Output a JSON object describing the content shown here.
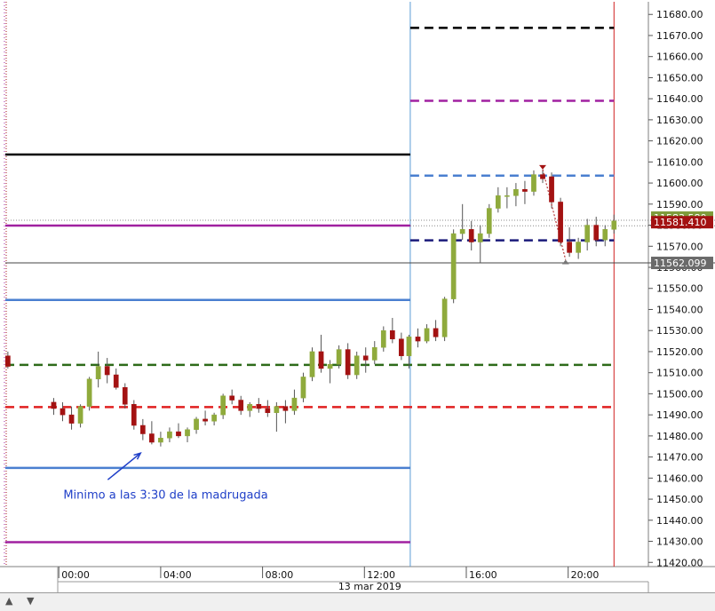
{
  "chart_data": {
    "type": "candlestick",
    "y_ticks": [
      "11420.00",
      "11430.00",
      "11440.00",
      "11450.00",
      "11460.00",
      "11470.00",
      "11480.00",
      "11490.00",
      "11500.00",
      "11510.00",
      "11520.00",
      "11530.00",
      "11540.00",
      "11550.00",
      "11560.00",
      "11570.00",
      "11580.00",
      "11590.00",
      "11600.00",
      "11610.00",
      "11620.00",
      "11630.00",
      "11640.00",
      "11650.00",
      "11660.00",
      "11670.00",
      "11680.00"
    ],
    "ylim": [
      11418,
      11686
    ],
    "x_ticks": [
      "00:00",
      "04:00",
      "08:00",
      "12:00",
      "16:00",
      "20:00"
    ],
    "x_tick_hours": [
      0,
      4,
      8,
      12,
      16,
      20
    ],
    "xlim_hours": [
      -2.1,
      23.15
    ],
    "date_label": "13 mar 2019",
    "date_label_hour": 10.1,
    "last_price_label": "11581.410",
    "crosshair_label": "11562.099",
    "partial_label": "11583.580",
    "crosshair_value": 11562.099,
    "last_price_value": 11581.41,
    "partial_value": 11583.58,
    "annotation": {
      "text": "Minimo a las 3:30 de la madrugada",
      "x_hour": -0.1,
      "y": 11452,
      "arrow_from": [
        -0.1,
        11455
      ],
      "arrow_to": [
        3.0,
        11471
      ]
    },
    "session_line_hour": 13.8,
    "end_line_hour": 21.8,
    "colors": {
      "up": "#8faa3c",
      "down": "#a31212",
      "session": "#5b9bd5",
      "end": "#d02020",
      "annotation": "#1f3fc8",
      "black": "#000000",
      "magenta": "#a020a0",
      "blue": "#4a7fd0",
      "green": "#2e6b1a",
      "red": "#e02020",
      "navy": "#1a1a7a"
    },
    "levels": [
      {
        "y": 11613.5,
        "x0": -2.1,
        "x1": 13.8,
        "color": "#000000",
        "dash": false,
        "w": 2.5
      },
      {
        "y": 11579.8,
        "x0": -2.1,
        "x1": 13.8,
        "color": "#a020a0",
        "dash": false,
        "w": 2.5
      },
      {
        "y": 11544.5,
        "x0": -2.1,
        "x1": 13.8,
        "color": "#4a7fd0",
        "dash": false,
        "w": 2.5
      },
      {
        "y": 11513.7,
        "x0": -2.1,
        "x1": 21.8,
        "color": "#2e6b1a",
        "dash": true,
        "w": 2.5
      },
      {
        "y": 11493.7,
        "x0": -2.1,
        "x1": 21.8,
        "color": "#e02020",
        "dash": true,
        "w": 2.5
      },
      {
        "y": 11464.8,
        "x0": -2.1,
        "x1": 13.8,
        "color": "#4a7fd0",
        "dash": false,
        "w": 2.5
      },
      {
        "y": 11429.6,
        "x0": -2.1,
        "x1": 13.8,
        "color": "#a020a0",
        "dash": false,
        "w": 2.5
      },
      {
        "y": 11673.6,
        "x0": 13.8,
        "x1": 21.8,
        "color": "#000000",
        "dash": true,
        "w": 2.5
      },
      {
        "y": 11639.0,
        "x0": 13.8,
        "x1": 21.8,
        "color": "#a020a0",
        "dash": true,
        "w": 2.5
      },
      {
        "y": 11603.5,
        "x0": 13.8,
        "x1": 21.8,
        "color": "#4a7fd0",
        "dash": true,
        "w": 2.5
      },
      {
        "y": 11572.8,
        "x0": 13.8,
        "x1": 21.8,
        "color": "#1a1a7a",
        "dash": true,
        "w": 2.5
      }
    ],
    "candles": [
      [
        -2.0,
        11518,
        11520,
        11512,
        11513
      ],
      [
        -0.2,
        11496,
        11498,
        11490,
        11493
      ],
      [
        0.15,
        11493,
        11496,
        11487,
        11490
      ],
      [
        0.5,
        11490,
        11494,
        11483,
        11486
      ],
      [
        0.85,
        11486,
        11495,
        11484,
        11494
      ],
      [
        1.2,
        11494,
        11508,
        11492,
        11507
      ],
      [
        1.55,
        11507,
        11520,
        11503,
        11513
      ],
      [
        1.9,
        11513,
        11517,
        11505,
        11509
      ],
      [
        2.25,
        11509,
        11512,
        11502,
        11503
      ],
      [
        2.6,
        11503,
        11505,
        11493,
        11495
      ],
      [
        2.95,
        11495,
        11497,
        11483,
        11485
      ],
      [
        3.3,
        11485,
        11488,
        11478,
        11481
      ],
      [
        3.65,
        11481,
        11487,
        11476,
        11477
      ],
      [
        4.0,
        11477,
        11482,
        11475,
        11479
      ],
      [
        4.35,
        11479,
        11484,
        11477,
        11482
      ],
      [
        4.7,
        11482,
        11486,
        11479,
        11480
      ],
      [
        5.05,
        11480,
        11484,
        11477,
        11483
      ],
      [
        5.4,
        11483,
        11489,
        11481,
        11488
      ],
      [
        5.75,
        11488,
        11492,
        11485,
        11487
      ],
      [
        6.1,
        11487,
        11491,
        11485,
        11490
      ],
      [
        6.45,
        11490,
        11500,
        11488,
        11499
      ],
      [
        6.8,
        11499,
        11502,
        11495,
        11497
      ],
      [
        7.15,
        11497,
        11499,
        11490,
        11492
      ],
      [
        7.5,
        11492,
        11496,
        11489,
        11495
      ],
      [
        7.85,
        11495,
        11498,
        11491,
        11493
      ],
      [
        8.2,
        11493,
        11497,
        11489,
        11491
      ],
      [
        8.55,
        11491,
        11496,
        11482,
        11494
      ],
      [
        8.9,
        11494,
        11497,
        11486,
        11492
      ],
      [
        9.25,
        11492,
        11502,
        11490,
        11498
      ],
      [
        9.6,
        11498,
        11510,
        11496,
        11508
      ],
      [
        9.95,
        11508,
        11522,
        11506,
        11520
      ],
      [
        10.3,
        11520,
        11528,
        11510,
        11512
      ],
      [
        10.65,
        11512,
        11516,
        11505,
        11514
      ],
      [
        11.0,
        11514,
        11523,
        11512,
        11521
      ],
      [
        11.35,
        11521,
        11524,
        11507,
        11509
      ],
      [
        11.7,
        11509,
        11520,
        11507,
        11518
      ],
      [
        12.05,
        11518,
        11522,
        11510,
        11516
      ],
      [
        12.4,
        11516,
        11525,
        11514,
        11522
      ],
      [
        12.75,
        11522,
        11532,
        11520,
        11530
      ],
      [
        13.1,
        11530,
        11536,
        11524,
        11526
      ],
      [
        13.45,
        11526,
        11529,
        11516,
        11518
      ],
      [
        13.75,
        11518,
        11528,
        11512,
        11527
      ],
      [
        14.1,
        11527,
        11531,
        11522,
        11525
      ],
      [
        14.45,
        11525,
        11533,
        11524,
        11531
      ],
      [
        14.8,
        11531,
        11535,
        11525,
        11527
      ],
      [
        15.15,
        11527,
        11546,
        11525,
        11545
      ],
      [
        15.5,
        11545,
        11578,
        11543,
        11576
      ],
      [
        15.85,
        11576,
        11590,
        11573,
        11578
      ],
      [
        16.2,
        11578,
        11582,
        11568,
        11572
      ],
      [
        16.55,
        11572,
        11580,
        11562,
        11576
      ],
      [
        16.9,
        11576,
        11590,
        11574,
        11588
      ],
      [
        17.25,
        11588,
        11598,
        11586,
        11594
      ],
      [
        17.6,
        11594,
        11598,
        11588,
        11594
      ],
      [
        17.95,
        11594,
        11600,
        11589,
        11597
      ],
      [
        18.3,
        11597,
        11601,
        11590,
        11596
      ],
      [
        18.65,
        11596,
        11606,
        11594,
        11604
      ],
      [
        19.0,
        11604,
        11606,
        11600,
        11602
      ],
      [
        19.35,
        11603,
        11605,
        11588,
        11591
      ],
      [
        19.7,
        11591,
        11593,
        11570,
        11572
      ],
      [
        20.05,
        11572,
        11579,
        11565,
        11567
      ],
      [
        20.4,
        11567,
        11574,
        11564,
        11572
      ],
      [
        20.75,
        11572,
        11583,
        11568,
        11580
      ],
      [
        21.1,
        11580,
        11584,
        11570,
        11573
      ],
      [
        21.45,
        11573,
        11580,
        11570,
        11578
      ],
      [
        21.8,
        11578,
        11585,
        11576,
        11582
      ]
    ]
  }
}
